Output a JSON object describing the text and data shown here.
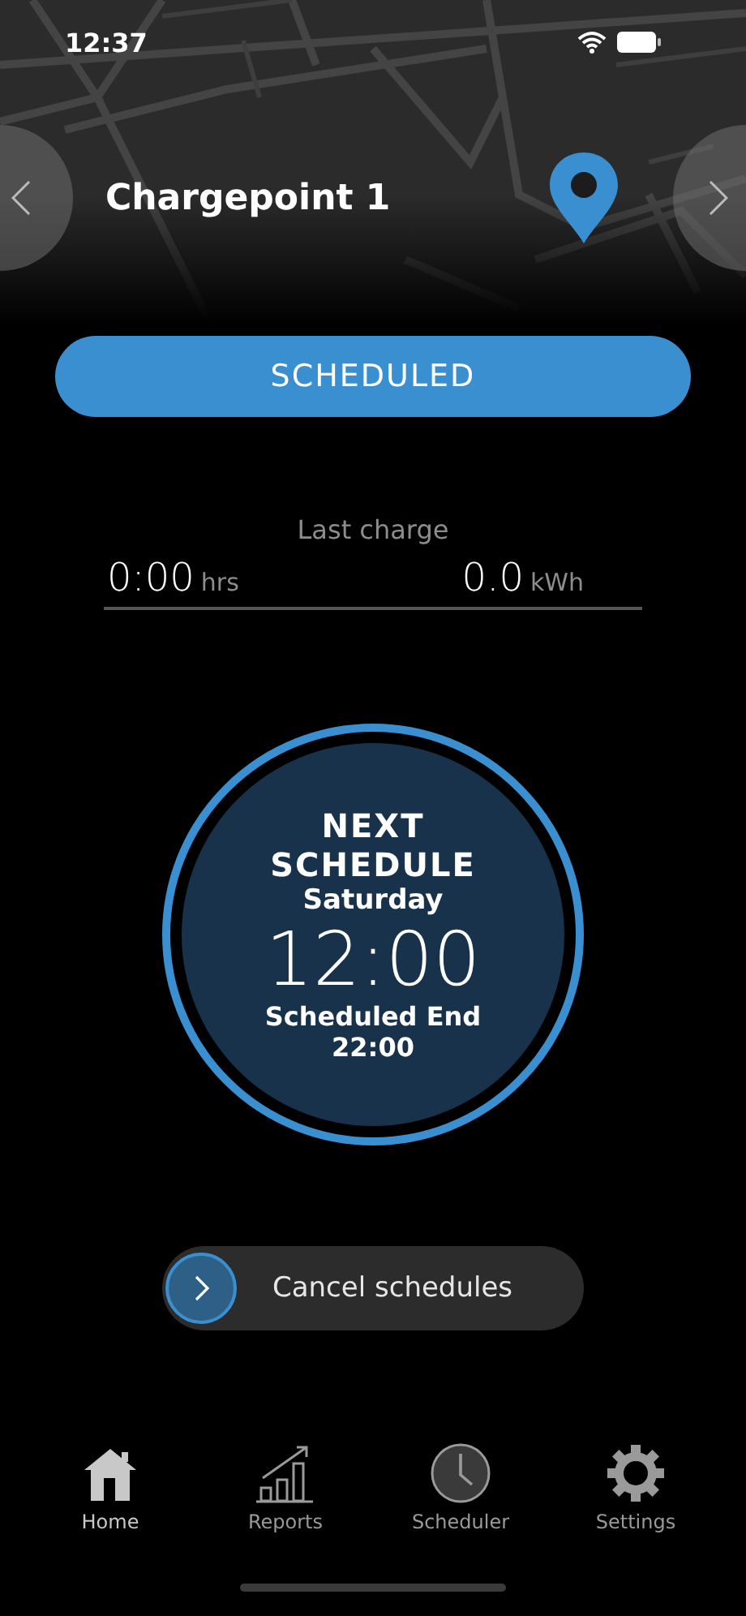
{
  "status_bar": {
    "time": "12:37"
  },
  "header": {
    "title": "Chargepoint 1"
  },
  "status_button": {
    "label": "SCHEDULED"
  },
  "last_charge": {
    "label": "Last charge",
    "duration": "0:00",
    "duration_unit": "hrs",
    "energy": "0.0",
    "energy_unit": "kWh"
  },
  "schedule": {
    "heading_1": "NEXT",
    "heading_2": "SCHEDULE",
    "day": "Saturday",
    "start": "12:00",
    "end_label": "Scheduled End",
    "end": "22:00"
  },
  "cancel_slider": {
    "label": "Cancel schedules",
    "level": 0
  },
  "tabs": [
    {
      "label": "Home",
      "kind": "home",
      "selected": true
    },
    {
      "label": "Reports",
      "kind": "reports",
      "selected": false
    },
    {
      "label": "Scheduler",
      "kind": "scheduler",
      "selected": false
    },
    {
      "label": "Settings",
      "kind": "settings",
      "selected": false
    }
  ]
}
